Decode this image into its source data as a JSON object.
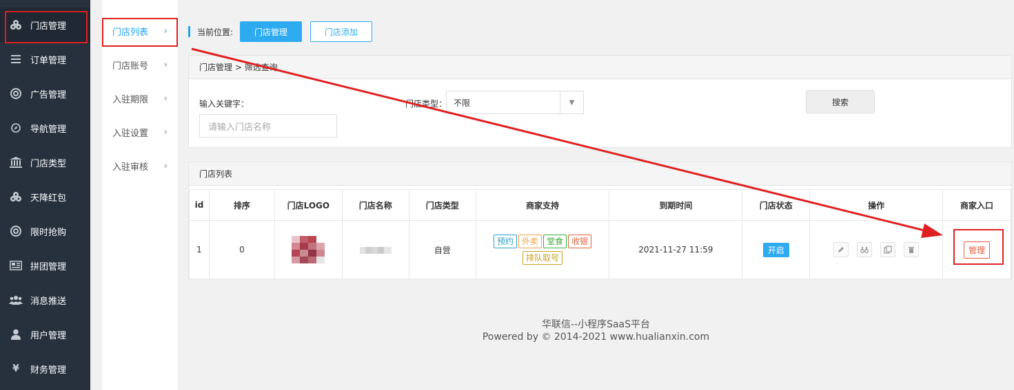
{
  "sidebar": {
    "items": [
      {
        "label": "门店管理",
        "icon": "cubes-icon"
      },
      {
        "label": "订单管理",
        "icon": "list-icon"
      },
      {
        "label": "广告管理",
        "icon": "lifebuoy-icon"
      },
      {
        "label": "导航管理",
        "icon": "compass-icon"
      },
      {
        "label": "门店类型",
        "icon": "bank-icon"
      },
      {
        "label": "天降红包",
        "icon": "cubes-icon"
      },
      {
        "label": "限时抢购",
        "icon": "lifebuoy-icon"
      },
      {
        "label": "拼团管理",
        "icon": "newspaper-icon"
      },
      {
        "label": "消息推送",
        "icon": "users-icon"
      },
      {
        "label": "用户管理",
        "icon": "user-icon"
      },
      {
        "label": "财务管理",
        "icon": "yen-icon"
      }
    ]
  },
  "subnav": {
    "items": [
      {
        "label": "门店列表"
      },
      {
        "label": "门店账号"
      },
      {
        "label": "入驻期限"
      },
      {
        "label": "入驻设置"
      },
      {
        "label": "入驻审核"
      }
    ],
    "chevron": "›"
  },
  "crumb": {
    "label": "当前位置:",
    "current": "门店管理",
    "add": "门店添加"
  },
  "filter": {
    "header": "门店管理 > 筛选查询",
    "keyword_label": "输入关键字：",
    "keyword_placeholder": "请输入门店名称",
    "type_label": "门店类型：",
    "type_value": "不限",
    "search": "搜索"
  },
  "list": {
    "header": "门店列表",
    "columns": [
      "id",
      "排序",
      "门店LOGO",
      "门店名称",
      "门店类型",
      "商家支持",
      "到期时间",
      "门店状态",
      "操作",
      "商家入口"
    ],
    "rows": [
      {
        "id": "1",
        "sort": "0",
        "type": "自营",
        "support": [
          "预约",
          "外卖",
          "堂食",
          "收银",
          "排队取号"
        ],
        "expire": "2021-11-27 11:59",
        "status": "开启",
        "manage": "管理"
      }
    ]
  },
  "footer": {
    "line1": "华联信--小程序SaaS平台",
    "line2": "Powered by © 2014-2021 www.hualianxin.com"
  },
  "colors": {
    "accent": "#2eabf0",
    "annotation": "#e02020"
  }
}
